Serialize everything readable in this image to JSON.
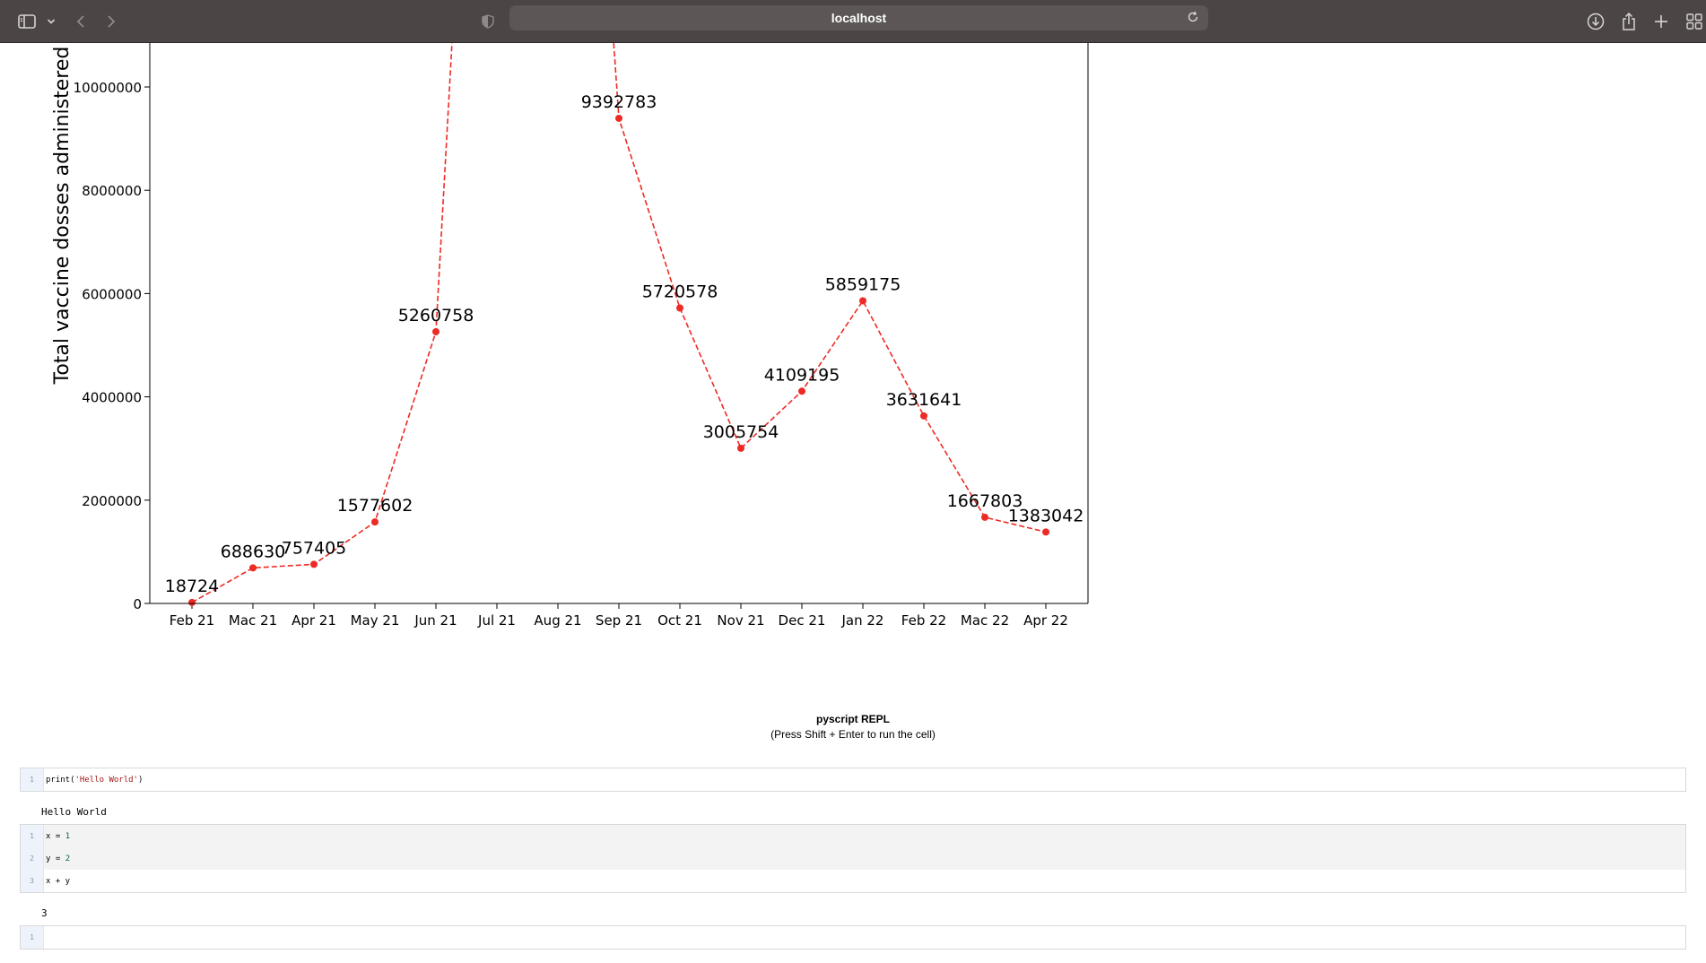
{
  "browser": {
    "address": "localhost",
    "icons": [
      "sidebar-icon",
      "chevron-down-icon",
      "back-icon",
      "forward-icon",
      "shield-icon",
      "reload-icon",
      "download-icon",
      "share-icon",
      "plus-icon",
      "tabs-grid-icon"
    ]
  },
  "chart_data": {
    "type": "line",
    "ylabel": "Total vaccine dosses administered",
    "categories": [
      "Feb 21",
      "Mac 21",
      "Apr 21",
      "May 21",
      "Jun 21",
      "Jul 21",
      "Aug 21",
      "Sep 21",
      "Oct 21",
      "Nov 21",
      "Dec 21",
      "Jan 22",
      "Feb 22",
      "Mac 22",
      "Apr 22"
    ],
    "values": [
      18724,
      688630,
      757405,
      1577602,
      5260758,
      null,
      null,
      9392783,
      5720578,
      3005754,
      4109195,
      5859175,
      3631641,
      1667803,
      1383042
    ],
    "yticks": [
      "0",
      "2000000",
      "4000000",
      "6000000",
      "8000000",
      "10000000"
    ],
    "ytick_values": [
      0,
      2000000,
      4000000,
      6000000,
      8000000,
      10000000
    ],
    "line_color": "#ee2a24",
    "line_style": "dashed",
    "marker": "circle",
    "grid": false
  },
  "repl": {
    "title": "pyscript REPL",
    "subtitle": "(Press Shift + Enter to run the cell)",
    "cells": [
      {
        "lines": [
          {
            "num": "1",
            "code": "print('Hello World')"
          }
        ],
        "output": "Hello World"
      },
      {
        "lines": [
          {
            "num": "1",
            "code": "x = 1"
          },
          {
            "num": "2",
            "code": "y = 2"
          },
          {
            "num": "3",
            "code": "x + y"
          }
        ],
        "output": "3"
      },
      {
        "lines": [
          {
            "num": "1",
            "code": ""
          }
        ],
        "output": ""
      }
    ]
  }
}
